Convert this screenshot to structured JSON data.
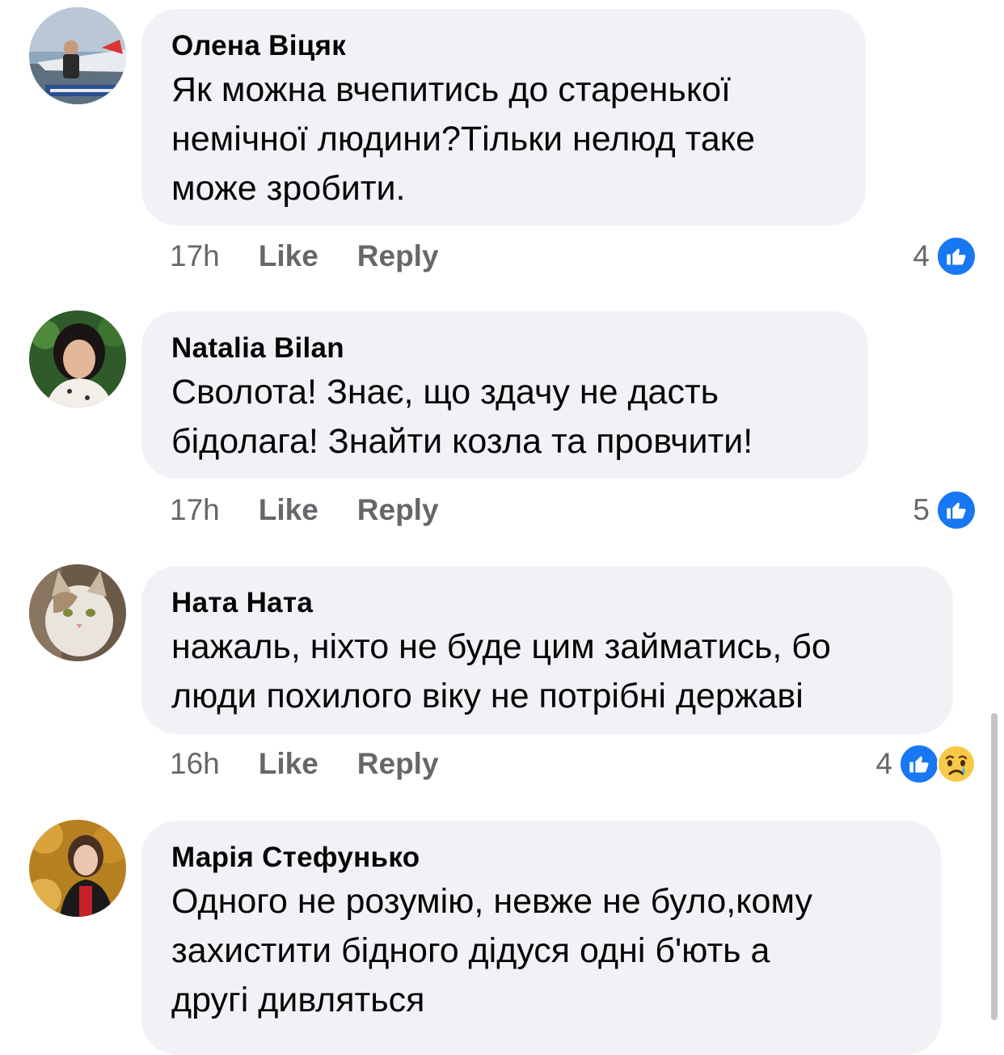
{
  "comments": [
    {
      "author": "Олена Віцяк",
      "text": "Як можна вчепитись до старенької\nнемічної людини?Тільки нелюд таке\nможе зробити.",
      "time": "17h",
      "like_label": "Like",
      "reply_label": "Reply",
      "reaction_count": "4",
      "reactions": [
        "like"
      ]
    },
    {
      "author": "Natalia Bilan",
      "text": "Сволота! Знає, що здачу не дасть\nбідолага! Знайти козла та провчити!",
      "time": "17h",
      "like_label": "Like",
      "reply_label": "Reply",
      "reaction_count": "5",
      "reactions": [
        "like"
      ]
    },
    {
      "author": "Ната Ната",
      "text": "нажаль, ніхто не буде цим займатись, бо\nлюди похилого віку не потрібні державі",
      "time": "16h",
      "like_label": "Like",
      "reply_label": "Reply",
      "reaction_count": "4",
      "reactions": [
        "like",
        "sad"
      ]
    },
    {
      "author": "Марія Стефунько",
      "text": "Одного не розумію, невже не було,кому\nзахистити бідного дідуся одні б'ють а\nдругі дивляться"
    }
  ],
  "colors": {
    "bubble": "#f0f2f5",
    "like_blue": "#1877f2",
    "meta_gray": "#65676b",
    "text": "#050505"
  }
}
